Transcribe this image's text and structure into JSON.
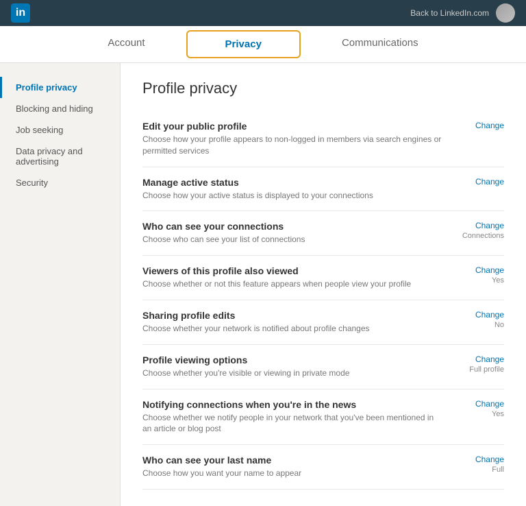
{
  "topbar": {
    "logo_text": "in",
    "back_label": "Back to LinkedIn.com"
  },
  "tabs": [
    {
      "id": "account",
      "label": "Account",
      "active": false,
      "highlighted": false
    },
    {
      "id": "privacy",
      "label": "Privacy",
      "active": true,
      "highlighted": true
    },
    {
      "id": "communications",
      "label": "Communications",
      "active": false,
      "highlighted": false
    }
  ],
  "sidebar": {
    "items": [
      {
        "id": "profile-privacy",
        "label": "Profile privacy",
        "active": true
      },
      {
        "id": "blocking-hiding",
        "label": "Blocking and hiding",
        "active": false
      },
      {
        "id": "job-seeking",
        "label": "Job seeking",
        "active": false
      },
      {
        "id": "data-privacy",
        "label": "Data privacy and advertising",
        "active": false
      },
      {
        "id": "security",
        "label": "Security",
        "active": false
      }
    ]
  },
  "content": {
    "title": "Profile privacy",
    "settings": [
      {
        "id": "public-profile",
        "title": "Edit your public profile",
        "desc": "Choose how your profile appears to non-logged in members via search engines or permitted services",
        "change_label": "Change",
        "value": ""
      },
      {
        "id": "active-status",
        "title": "Manage active status",
        "desc": "Choose how your active status is displayed to your connections",
        "change_label": "Change",
        "value": ""
      },
      {
        "id": "connections",
        "title": "Who can see your connections",
        "desc": "Choose who can see your list of connections",
        "change_label": "Change",
        "value": "Connections"
      },
      {
        "id": "viewers-also-viewed",
        "title": "Viewers of this profile also viewed",
        "desc": "Choose whether or not this feature appears when people view your profile",
        "change_label": "Change",
        "value": "Yes"
      },
      {
        "id": "sharing-edits",
        "title": "Sharing profile edits",
        "desc": "Choose whether your network is notified about profile changes",
        "change_label": "Change",
        "value": "No"
      },
      {
        "id": "profile-viewing",
        "title": "Profile viewing options",
        "desc": "Choose whether you're visible or viewing in private mode",
        "change_label": "Change",
        "value": "Full profile"
      },
      {
        "id": "news-notifications",
        "title": "Notifying connections when you're in the news",
        "desc": "Choose whether we notify people in your network that you've been mentioned in an article or blog post",
        "change_label": "Change",
        "value": "Yes"
      },
      {
        "id": "last-name",
        "title": "Who can see your last name",
        "desc": "Choose how you want your name to appear",
        "change_label": "Change",
        "value": "Full"
      }
    ]
  }
}
